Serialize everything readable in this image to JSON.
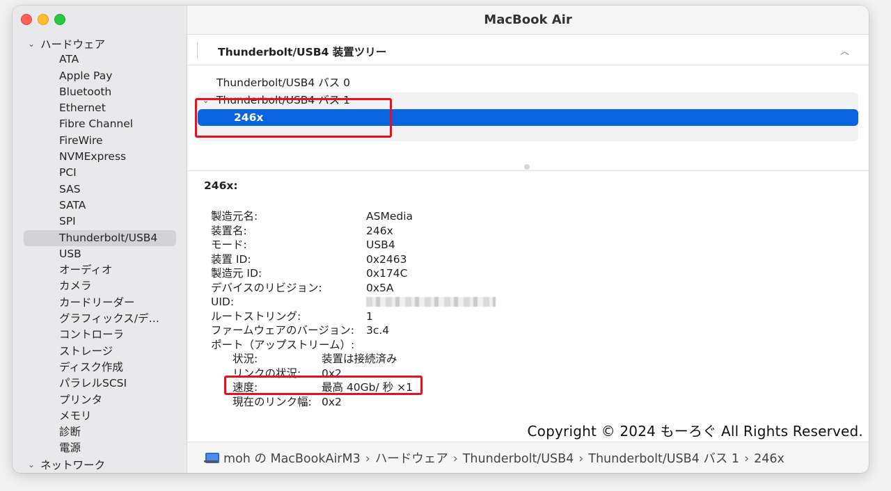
{
  "window": {
    "title": "MacBook Air"
  },
  "sidebar": {
    "section_hardware": "ハードウェア",
    "items": [
      "ATA",
      "Apple Pay",
      "Bluetooth",
      "Ethernet",
      "Fibre Channel",
      "FireWire",
      "NVMExpress",
      "PCI",
      "SAS",
      "SATA",
      "SPI",
      "Thunderbolt/USB4",
      "USB",
      "オーディオ",
      "カメラ",
      "カードリーダー",
      "グラフィックス/デ…",
      "コントローラ",
      "ストレージ",
      "ディスク作成",
      "パラレルSCSI",
      "プリンタ",
      "メモリ",
      "診断",
      "電源"
    ],
    "selected": "Thunderbolt/USB4",
    "section_network": "ネットワーク"
  },
  "section": {
    "title": "Thunderbolt/USB4 装置ツリー"
  },
  "tree": {
    "bus0": "Thunderbolt/USB4 バス 0",
    "bus1": "Thunderbolt/USB4 バス 1",
    "selected_device": "246x"
  },
  "detail": {
    "title": "246x:",
    "rows": [
      {
        "k": "製造元名:",
        "v": "ASMedia"
      },
      {
        "k": "装置名:",
        "v": "246x"
      },
      {
        "k": "モード:",
        "v": "USB4"
      },
      {
        "k": "装置 ID:",
        "v": "0x2463"
      },
      {
        "k": "製造元 ID:",
        "v": "0x174C"
      },
      {
        "k": "デバイスのリビジョン:",
        "v": "0x5A"
      },
      {
        "k": "UID:",
        "v": ""
      },
      {
        "k": "ルートストリング:",
        "v": "1"
      },
      {
        "k": "ファームウェアのバージョン:",
        "v": "3c.4"
      },
      {
        "k": "ポート（アップストリーム）:",
        "v": ""
      }
    ],
    "port_rows": [
      {
        "k": "状況:",
        "v": "装置は接続済み"
      },
      {
        "k": "リンクの状況:",
        "v": "0x2"
      },
      {
        "k": "速度:",
        "v": "最高 40Gb/ 秒 ×1"
      },
      {
        "k": "現在のリンク幅:",
        "v": "0x2"
      }
    ]
  },
  "watermark": "Copyright © 2024 もーろぐ All Rights Reserved.",
  "pathbar": {
    "items": [
      "moh の MacBookAirM3",
      "ハードウェア",
      "Thunderbolt/USB4",
      "Thunderbolt/USB4 バス 1",
      "246x"
    ]
  },
  "colors": {
    "selection": "#0a63e0",
    "highlight_box": "#e8101c"
  }
}
